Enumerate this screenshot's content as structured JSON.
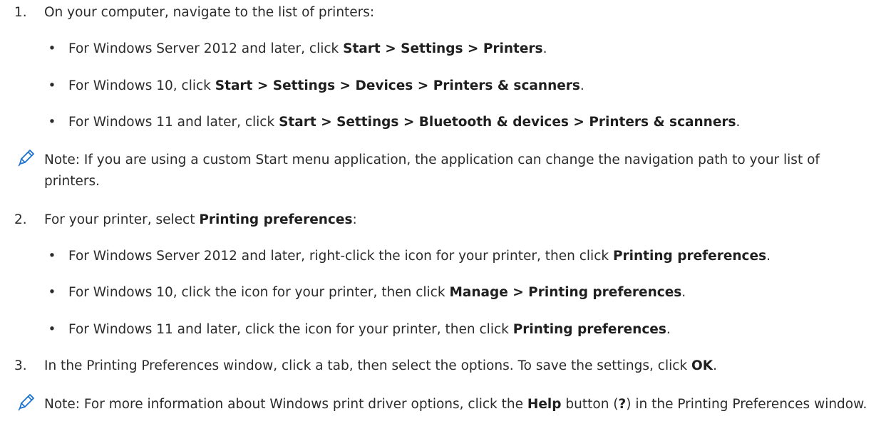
{
  "steps": [
    {
      "number": "1.",
      "pre": "On your computer, navigate to the list of printers:",
      "bullets": [
        {
          "pre": "For Windows Server 2012 and later, click ",
          "bold": "Start > Settings > Printers",
          "post": "."
        },
        {
          "pre": "For Windows 10, click ",
          "bold": "Start > Settings > Devices > Printers & scanners",
          "post": "."
        },
        {
          "pre": "For Windows 11 and later, click ",
          "bold": "Start > Settings > Bluetooth & devices > Printers & scanners",
          "post": "."
        }
      ],
      "note": {
        "text": "Note: If you are using a custom Start menu application, the application can change the navigation path to your list of printers."
      }
    },
    {
      "number": "2.",
      "pre": "For your printer, select ",
      "bold": "Printing preferences",
      "post": ":",
      "bullets": [
        {
          "pre": "For Windows Server 2012 and later, right-click the icon for your printer, then click ",
          "bold": "Printing preferences",
          "post": "."
        },
        {
          "pre": "For Windows 10, click the icon for your printer, then click ",
          "bold": "Manage > Printing preferences",
          "post": "."
        },
        {
          "pre": "For Windows 11 and later, click the icon for your printer, then click ",
          "bold": "Printing preferences",
          "post": "."
        }
      ]
    },
    {
      "number": "3.",
      "pre": "In the Printing Preferences window, click a tab, then select the options. To save the settings, click ",
      "bold": "OK",
      "post": ".",
      "note": {
        "pre": "Note: For more information about Windows print driver options, click the ",
        "bold1": "Help",
        "mid": " button (",
        "bold2": "?",
        "post": ") in the Printing Preferences window."
      }
    }
  ],
  "colors": {
    "text": "#2b2b2b",
    "note_icon": "#1a73d1"
  },
  "icons": {
    "note": "pencil-icon"
  }
}
